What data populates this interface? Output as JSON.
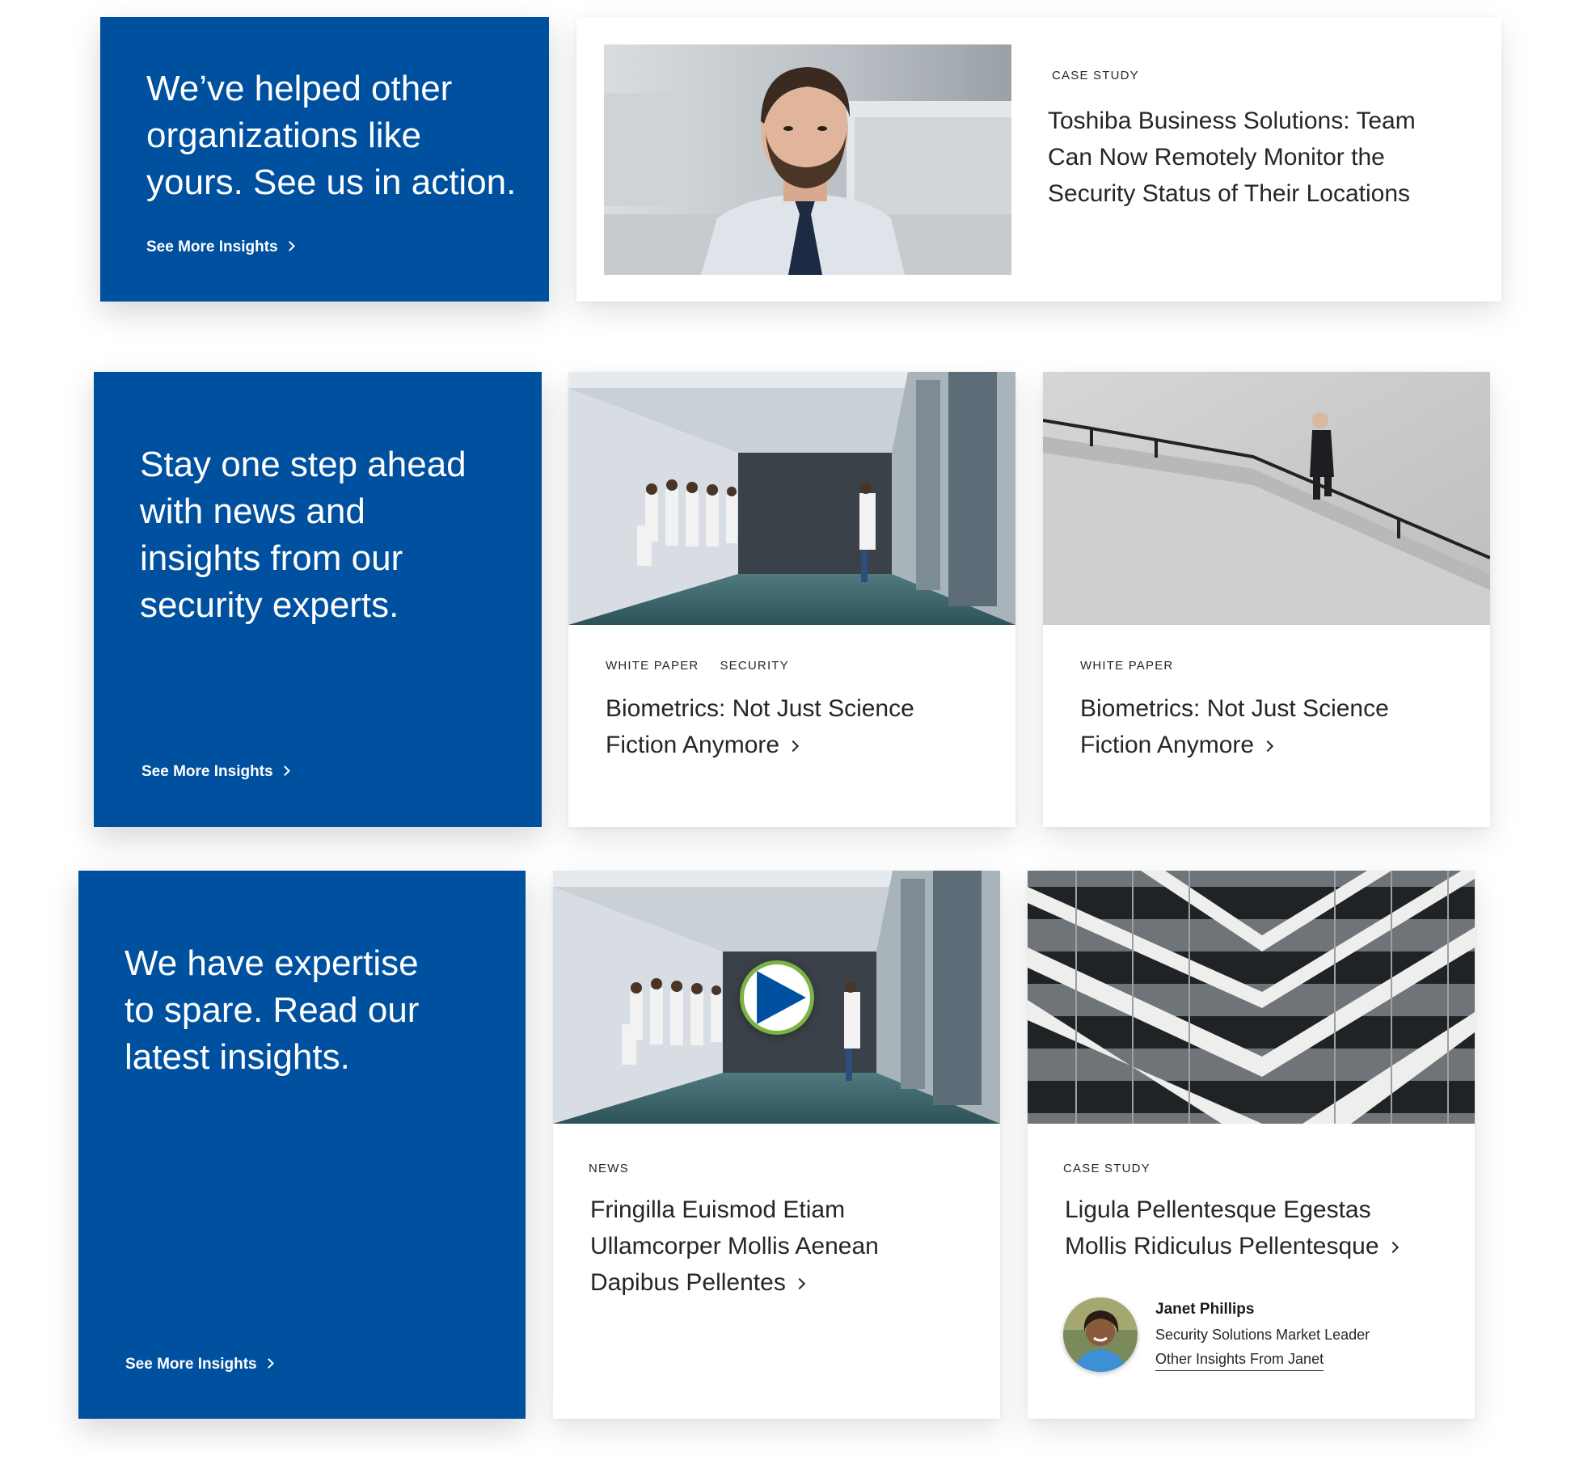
{
  "row1": {
    "promo": {
      "heading": "We’ve helped other organizations like yours. See us in action.",
      "link": "See More Insights"
    },
    "feature": {
      "tag": "CASE STUDY",
      "title": "Toshiba Business Solutions: Team Can Now Remotely Monitor the Security Status of Their Locations"
    }
  },
  "row2": {
    "promo": {
      "heading": "Stay one step ahead with news and insights from our security experts.",
      "link": "See More Insights"
    },
    "cards": [
      {
        "tags": [
          "WHITE PAPER",
          "SECURITY"
        ],
        "title": "Biometrics: Not Just Science Fiction Anymore"
      },
      {
        "tags": [
          "WHITE PAPER"
        ],
        "title": "Biometrics: Not Just Science Fiction Anymore"
      }
    ]
  },
  "row3": {
    "promo": {
      "heading": "We have expertise to spare. Read our latest insights.",
      "link": "See More Insights"
    },
    "cards": [
      {
        "tag": "NEWS",
        "title": "Fringilla Euismod Etiam Ullamcorper Mollis Aenean Dapibus Pellentes"
      },
      {
        "tag": "CASE STUDY",
        "title": "Ligula Pellentesque Egestas Mollis Ridiculus Pellentesque",
        "author": {
          "name": "Janet Phillips",
          "role": "Security Solutions Market Leader",
          "link": "Other Insights From Janet"
        }
      }
    ]
  },
  "icons": {
    "chevron": "chevron-right-icon",
    "play": "play-icon"
  },
  "colors": {
    "promo_blue": "#0050a0",
    "play_ring": "#7cb342",
    "play_triangle": "#0050a0",
    "text": "#262626"
  }
}
